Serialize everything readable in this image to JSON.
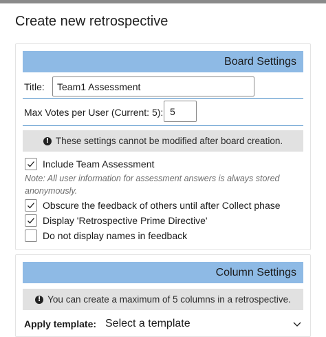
{
  "dialog": {
    "title": "Create new retrospective"
  },
  "board_settings": {
    "header": "Board Settings",
    "title_label": "Title:",
    "title_value": "Team1 Assessment",
    "max_votes_label": "Max Votes per User (Current: 5):",
    "max_votes_value": "5",
    "info": "These settings cannot be modified after board creation.",
    "options": [
      {
        "label": "Include Team Assessment",
        "checked": true
      },
      {
        "label": "Obscure the feedback of others until after Collect phase",
        "checked": true
      },
      {
        "label": "Display 'Retrospective Prime Directive'",
        "checked": true
      },
      {
        "label": "Do not display names in feedback",
        "checked": false
      }
    ],
    "note": "Note: All user information for assessment answers is always stored anonymously."
  },
  "column_settings": {
    "header": "Column Settings",
    "info": "You can create a maximum of 5 columns in a retrospective.",
    "template_label": "Apply template:",
    "template_value": "Select a template"
  },
  "colors": {
    "header_bg": "#8ebae5",
    "info_bg": "#e1e1e1",
    "accent": "#4c8fc9"
  },
  "icons": {
    "info": "info-icon",
    "check": "checkmark-icon",
    "dropdown": "chevron-down-icon"
  }
}
